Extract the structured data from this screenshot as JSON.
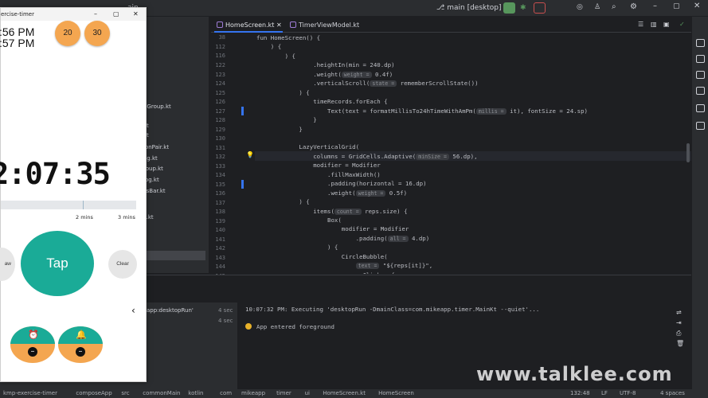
{
  "ide": {
    "branch_label": "main [desktop]",
    "branch_prefix": "ain",
    "tabs": [
      {
        "label": "HomeScreen.kt",
        "active": true
      },
      {
        "label": "TimerViewModel.kt",
        "active": false
      }
    ],
    "project_items": [
      "nGroup.kt",
      "kt",
      "kt",
      "lonPair.kt",
      "og.kt",
      "roup.kt",
      "log.kt",
      "ssBar.kt",
      "v.kt"
    ],
    "line_numbers": [
      "38",
      "112",
      "116",
      "122",
      "123",
      "124",
      "125",
      "126",
      "127",
      "128",
      "129",
      "130",
      "131",
      "132",
      "133",
      "134",
      "135",
      "136",
      "137",
      "138",
      "139",
      "140",
      "141",
      "142",
      "143",
      "144",
      "145",
      "146"
    ],
    "code_lines": [
      [
        "fun HomeScreen() {"
      ],
      [
        "    ) {"
      ],
      [
        "        ) {"
      ],
      [
        "                .heightIn(min = 240.dp)"
      ],
      [
        "                .weight(",
        "weight =",
        " 0.4f)"
      ],
      [
        "                .verticalScroll(",
        "state =",
        " rememberScrollState())"
      ],
      [
        "            ) {"
      ],
      [
        "                timeRecords.forEach {"
      ],
      [
        "                    Text(text = formatMillisTo24hTimeWithAmPm(",
        "millis =",
        " it), fontSize = 24.sp)"
      ],
      [
        "                }"
      ],
      [
        "            }"
      ],
      [
        ""
      ],
      [
        "            LazyVerticalGrid("
      ],
      [
        "                columns = GridCells.Adaptive(",
        "minSize =",
        " 56.dp),"
      ],
      [
        "                modifier = Modifier"
      ],
      [
        "                    .fillMaxWidth()"
      ],
      [
        "                    .padding(horizontal = 16.dp)"
      ],
      [
        "                    .weight(",
        "weight =",
        " 0.5f)"
      ],
      [
        "            ) {"
      ],
      [
        "                items(",
        "count =",
        " reps.size) {"
      ],
      [
        "                    Box("
      ],
      [
        "                        modifier = Modifier"
      ],
      [
        "                            .padding(",
        "all =",
        " 4.dp)"
      ],
      [
        "                    ) {"
      ],
      [
        "                        CircleBubble("
      ],
      [
        "                            ",
        "text =",
        " \"${reps[it]}\","
      ],
      [
        "                            onClick = {"
      ]
    ],
    "run_configs": [
      {
        "label": "app:desktopRun'",
        "time": "4 sec"
      },
      {
        "label": "",
        "time": "4 sec"
      }
    ],
    "console_lines": [
      "10:07:32 PM: Executing 'desktopRun -DmainClass=com.mikeapp.timer.MainKt --quiet'...",
      "App entered foreground"
    ],
    "breadcrumbs": [
      "kmp-exercise-timer",
      "composeApp",
      "src",
      "commonMain",
      "kotlin",
      "com",
      "mikeapp",
      "timer",
      "ui",
      "HomeScreen.kt",
      "HomeScreen"
    ],
    "status": {
      "position": "132:48",
      "line_sep": "LF",
      "encoding": "UTF-8",
      "indent": "4 spaces"
    }
  },
  "app": {
    "window_title": "ercise-timer",
    "times": [
      ":56 PM",
      ":57 PM"
    ],
    "bubbles": [
      "20",
      "30"
    ],
    "timer": "2:07:35",
    "progress_labels": [
      "2 mins",
      "3 mins"
    ],
    "tap_label": "Tap",
    "left_btn": "aw",
    "clear_label": "Clear",
    "back_glyph": "‹"
  },
  "watermark": "www.talklee.com",
  "colors": {
    "accent_teal": "#1aab97",
    "accent_orange": "#f4a650",
    "ide_bg": "#1e1f22"
  }
}
